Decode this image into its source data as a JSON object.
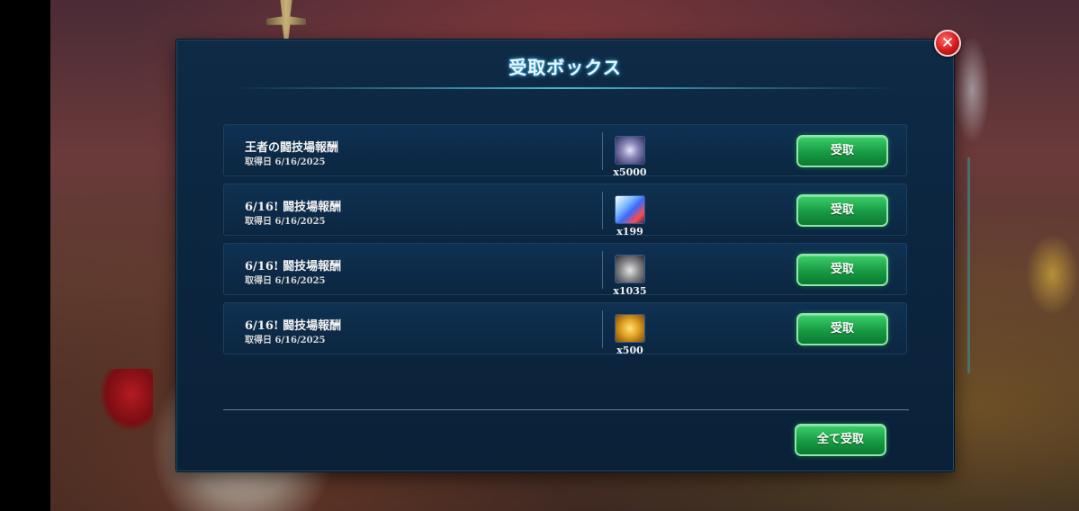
{
  "dialog": {
    "title": "受取ボックス",
    "close_icon": "close-icon"
  },
  "rewards": [
    {
      "name": "王者の闘技場報酬",
      "date": "取得日 6/16/2025",
      "icon": "gem-icon",
      "qty": "x5000",
      "button": "受取"
    },
    {
      "name": "6/16! 闘技場報酬",
      "date": "取得日 6/16/2025",
      "icon": "crystal-icon",
      "qty": "x199",
      "button": "受取"
    },
    {
      "name": "6/16! 闘技場報酬",
      "date": "取得日 6/16/2025",
      "icon": "helmet-icon",
      "qty": "x1035",
      "button": "受取"
    },
    {
      "name": "6/16! 闘技場報酬",
      "date": "取得日 6/16/2025",
      "icon": "coin-icon",
      "qty": "x500",
      "button": "受取"
    }
  ],
  "footer": {
    "claim_all_label": "全て受取"
  },
  "colors": {
    "panel": "#0c2640",
    "button": "#179a43",
    "close": "#d11a1a",
    "title_glow": "#2aa8d8"
  }
}
